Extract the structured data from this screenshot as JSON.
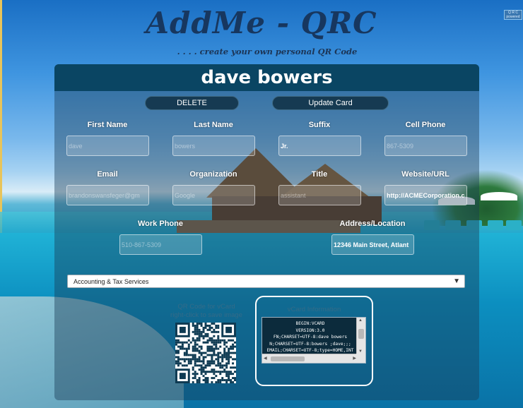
{
  "header": {
    "title": "AddMe - QRC",
    "tagline": ". . . . create your own personal QR Code"
  },
  "badge": {
    "text": "Q R C powered"
  },
  "card": {
    "name": "dave bowers",
    "buttons": {
      "delete": "DELETE",
      "update": "Update Card"
    },
    "fields": {
      "first_name": {
        "label": "First Name",
        "value": "",
        "placeholder": "dave"
      },
      "last_name": {
        "label": "Last Name",
        "value": "",
        "placeholder": "bowers"
      },
      "suffix": {
        "label": "Suffix",
        "value": "Jr.",
        "placeholder": ""
      },
      "cell_phone": {
        "label": "Cell Phone",
        "value": "",
        "placeholder": "867-5309"
      },
      "email": {
        "label": "Email",
        "value": "",
        "placeholder": "brandonswansfeger@gm"
      },
      "organization": {
        "label": "Organization",
        "value": "",
        "placeholder": "Google"
      },
      "title": {
        "label": "Title",
        "value": "",
        "placeholder": "assistant"
      },
      "website": {
        "label": "Website/URL",
        "value": "http://ACMECorporation.c",
        "placeholder": ""
      },
      "work_phone": {
        "label": "Work Phone",
        "value": "",
        "placeholder": "510-867-5309"
      },
      "address": {
        "label": "Address/Location",
        "value": "12346 Main Street, Atlant",
        "placeholder": ""
      }
    },
    "category": {
      "selected": "Accounting & Tax Services"
    },
    "qr": {
      "caption_line1": "QR Code for vCard",
      "caption_line2": "right-click to save image"
    },
    "vcard": {
      "title": "vCard Information",
      "text": "BEGIN:VCARD\nVERSION:3.0\nFN;CHARSET=UTF-8:dave bowers\nN;CHARSET=UTF-8:bowers ;dave;;;\nEMAIL;CHARSET=UTF-8;type=HOME,INT"
    }
  }
}
